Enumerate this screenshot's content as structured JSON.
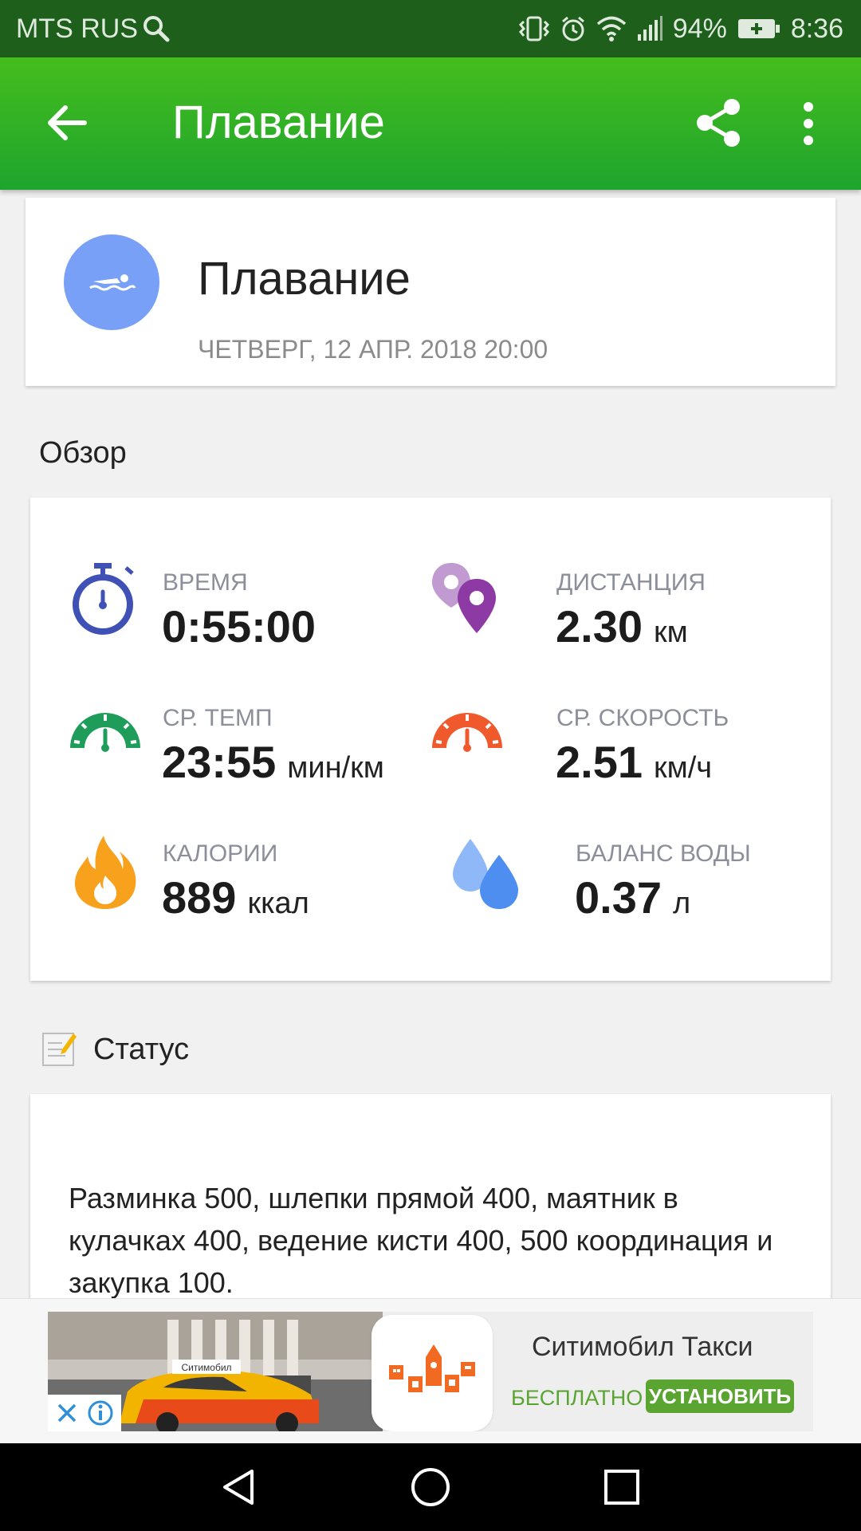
{
  "status_bar": {
    "carrier": "MTS RUS",
    "battery": "94%",
    "time": "8:36"
  },
  "app_bar": {
    "title": "Плавание",
    "icons": [
      "back-arrow-icon",
      "share-icon",
      "more-vert-icon"
    ]
  },
  "activity": {
    "title": "Плавание",
    "date": "ЧЕТВЕРГ, 12 АПР. 2018 20:00",
    "icon": "swimmer-icon",
    "icon_bg": "#78a0f6"
  },
  "overview": {
    "title": "Обзор",
    "stats": [
      {
        "label": "ВРЕМЯ",
        "value": "0:55:00",
        "unit": "",
        "icon": "stopwatch-icon",
        "color": "#3f51b5"
      },
      {
        "label": "ДИСТАНЦИЯ",
        "value": "2.30",
        "unit": "км",
        "icon": "location-pins-icon",
        "color": "#8e3aa4"
      },
      {
        "label": "СР. ТЕМП",
        "value": "23:55",
        "unit": "мин/км",
        "icon": "speedometer-green-icon",
        "color": "#1e9d5a"
      },
      {
        "label": "СР. СКОРОСТЬ",
        "value": "2.51",
        "unit": "км/ч",
        "icon": "speedometer-orange-icon",
        "color": "#f0592b"
      },
      {
        "label": "КАЛОРИИ",
        "value": "889",
        "unit": "ккал",
        "icon": "flame-icon",
        "color": "#f7a11d"
      },
      {
        "label": "БАЛАНС ВОДЫ",
        "value": "0.37",
        "unit": "л",
        "icon": "water-drops-icon",
        "color": "#4d8ef0"
      }
    ]
  },
  "status_note": {
    "title": "Статус",
    "text": "Разминка 500, шлепки прямой 400, маятник в кулачках 400, ведение кисти 400, 500 координация и закупка 100."
  },
  "ad": {
    "title": "Ситимобил Такси",
    "free_label": "БЕСПЛАТНО",
    "install_label": "УСТАНОВИТЬ",
    "car_sign": "Ситимобил"
  },
  "colors": {
    "app_bar": "#2fae26",
    "status_bar": "#1d5f1b",
    "accent_green": "#5aa531"
  }
}
